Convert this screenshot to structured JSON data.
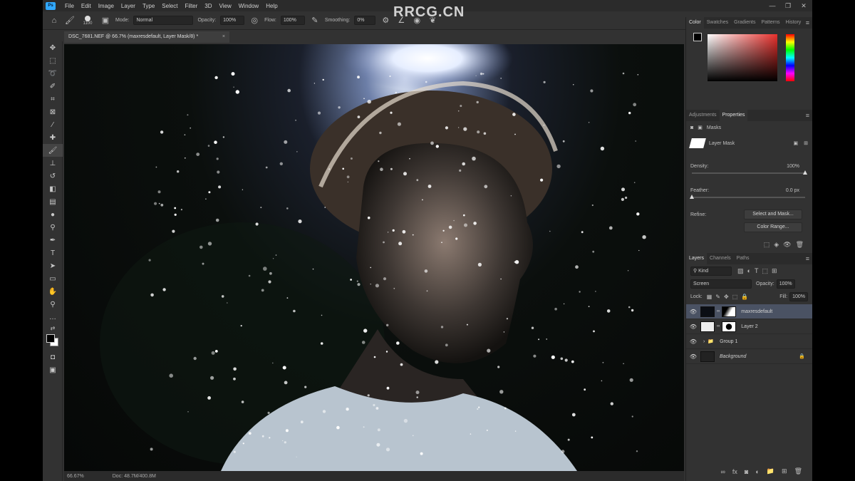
{
  "app": {
    "logo": "Ps"
  },
  "watermark": "RRCG.CN",
  "menu": [
    "File",
    "Edit",
    "Image",
    "Layer",
    "Type",
    "Select",
    "Filter",
    "3D",
    "View",
    "Window",
    "Help"
  ],
  "window_controls": {
    "minimize": "—",
    "restore": "❐",
    "close": "✕"
  },
  "options": {
    "brush_size": "1100",
    "mode_label": "Mode:",
    "mode_value": "Normal",
    "opacity_label": "Opacity:",
    "opacity_value": "100%",
    "flow_label": "Flow:",
    "flow_value": "100%",
    "smoothing_label": "Smoothing:",
    "smoothing_value": "0%"
  },
  "document": {
    "tab_title": "DSC_7681.NEF @ 66.7% (maxresdefault, Layer Mask/8) *",
    "close": "×"
  },
  "status": {
    "zoom": "66.67%",
    "doc": "Doc: 48.7M/400.8M"
  },
  "color_panel": {
    "tabs": [
      "Color",
      "Swatches",
      "Gradients",
      "Patterns",
      "History"
    ]
  },
  "props_panel": {
    "tabs": [
      "Adjustments",
      "Properties"
    ],
    "masks_label": "Masks",
    "layer_mask_label": "Layer Mask",
    "density_label": "Density:",
    "density_value": "100%",
    "feather_label": "Feather:",
    "feather_value": "0.0 px",
    "refine_label": "Refine:",
    "select_mask_btn": "Select and Mask...",
    "color_range_btn": "Color Range..."
  },
  "layers_panel": {
    "tabs": [
      "Layers",
      "Channels",
      "Paths"
    ],
    "kind_label": "Kind",
    "blend_mode": "Screen",
    "opacity_label": "Opacity:",
    "opacity_value": "100%",
    "lock_label": "Lock:",
    "fill_label": "Fill:",
    "fill_value": "100%",
    "layers": [
      {
        "name": "maxresdefault",
        "selected": true
      },
      {
        "name": "Layer 2"
      },
      {
        "name": "Group 1"
      },
      {
        "name": "Background"
      }
    ]
  },
  "colors": {
    "accent": "#31a8ff",
    "fg": "#000000",
    "bg": "#ffffff",
    "picker_hue": "#e8302c"
  }
}
